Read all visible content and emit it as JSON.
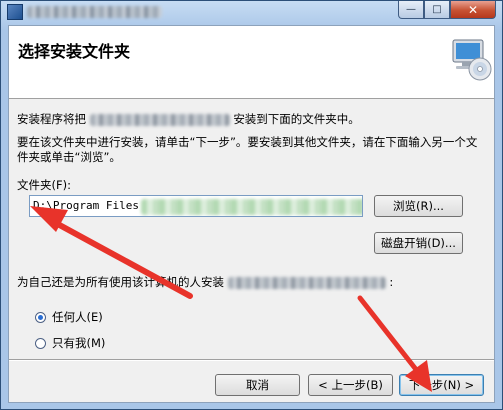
{
  "window": {
    "caption_buttons": {
      "minimize": "—",
      "maximize": "□",
      "close": "✕"
    }
  },
  "banner": {
    "title": "选择安装文件夹"
  },
  "body": {
    "intro_prefix": "安装程序将把",
    "intro_suffix": "安装到下面的文件夹中。",
    "instructions": "要在该文件夹中进行安装，请单击“下一步”。要安装到其他文件夹，请在下面输入另一个文件夹或单击“浏览”。",
    "folder_label": "文件夹(F):",
    "folder_value": "D:\\Program Files",
    "browse_label": "浏览(R)...",
    "disk_cost_label": "磁盘开销(D)...",
    "install_for_prefix": "为自己还是为所有使用该计算机的人安装",
    "install_for_suffix": ":",
    "radio_everyone": "任何人(E)",
    "radio_just_me": "只有我(M)"
  },
  "footer": {
    "cancel_label": "取消",
    "back_label": "< 上一步(B)",
    "next_label": "下一步(N) >"
  },
  "colors": {
    "annotation_arrow": "#e8332a",
    "title_bar": "#a9c6e8",
    "close_button": "#c75233"
  }
}
